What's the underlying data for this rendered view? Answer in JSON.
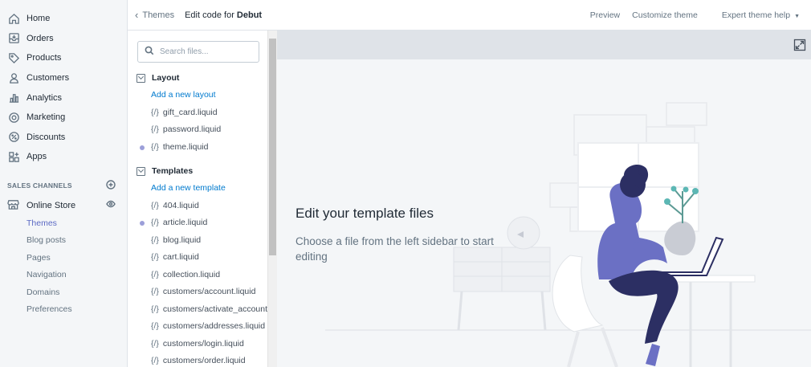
{
  "nav": {
    "items": [
      {
        "label": "Home",
        "icon": "home-icon"
      },
      {
        "label": "Orders",
        "icon": "orders-icon"
      },
      {
        "label": "Products",
        "icon": "tag-icon"
      },
      {
        "label": "Customers",
        "icon": "person-icon"
      },
      {
        "label": "Analytics",
        "icon": "bar-chart-icon"
      },
      {
        "label": "Marketing",
        "icon": "target-icon"
      },
      {
        "label": "Discounts",
        "icon": "discount-icon"
      },
      {
        "label": "Apps",
        "icon": "apps-icon"
      }
    ],
    "sales_channels_label": "SALES CHANNELS",
    "online_store_label": "Online Store",
    "sub_items": [
      {
        "label": "Themes",
        "active": true
      },
      {
        "label": "Blog posts"
      },
      {
        "label": "Pages"
      },
      {
        "label": "Navigation"
      },
      {
        "label": "Domains"
      },
      {
        "label": "Preferences"
      }
    ]
  },
  "topbar": {
    "back_label": "Themes",
    "title_prefix": "Edit code for ",
    "theme_name": "Debut",
    "actions": {
      "preview": "Preview",
      "customize": "Customize theme",
      "help": "Expert theme help"
    }
  },
  "files": {
    "search_placeholder": "Search files...",
    "layout": {
      "label": "Layout",
      "add_label": "Add a new layout",
      "files": [
        {
          "name": "gift_card.liquid"
        },
        {
          "name": "password.liquid"
        },
        {
          "name": "theme.liquid",
          "dot": true
        }
      ]
    },
    "templates": {
      "label": "Templates",
      "add_label": "Add a new template",
      "files": [
        {
          "name": "404.liquid"
        },
        {
          "name": "article.liquid",
          "dot": true
        },
        {
          "name": "blog.liquid"
        },
        {
          "name": "cart.liquid"
        },
        {
          "name": "collection.liquid"
        },
        {
          "name": "customers/account.liquid"
        },
        {
          "name": "customers/activate_account.liquid"
        },
        {
          "name": "customers/addresses.liquid"
        },
        {
          "name": "customers/login.liquid"
        },
        {
          "name": "customers/order.liquid"
        }
      ]
    },
    "code_glyph": "{/}"
  },
  "editor": {
    "empty_title": "Edit your template files",
    "empty_desc": "Choose a file from the left sidebar to start editing"
  },
  "colors": {
    "accent": "#5c6ac4",
    "link": "#007ace",
    "illustration_purple": "#6b70c4",
    "illustration_navy": "#2c2f63"
  }
}
